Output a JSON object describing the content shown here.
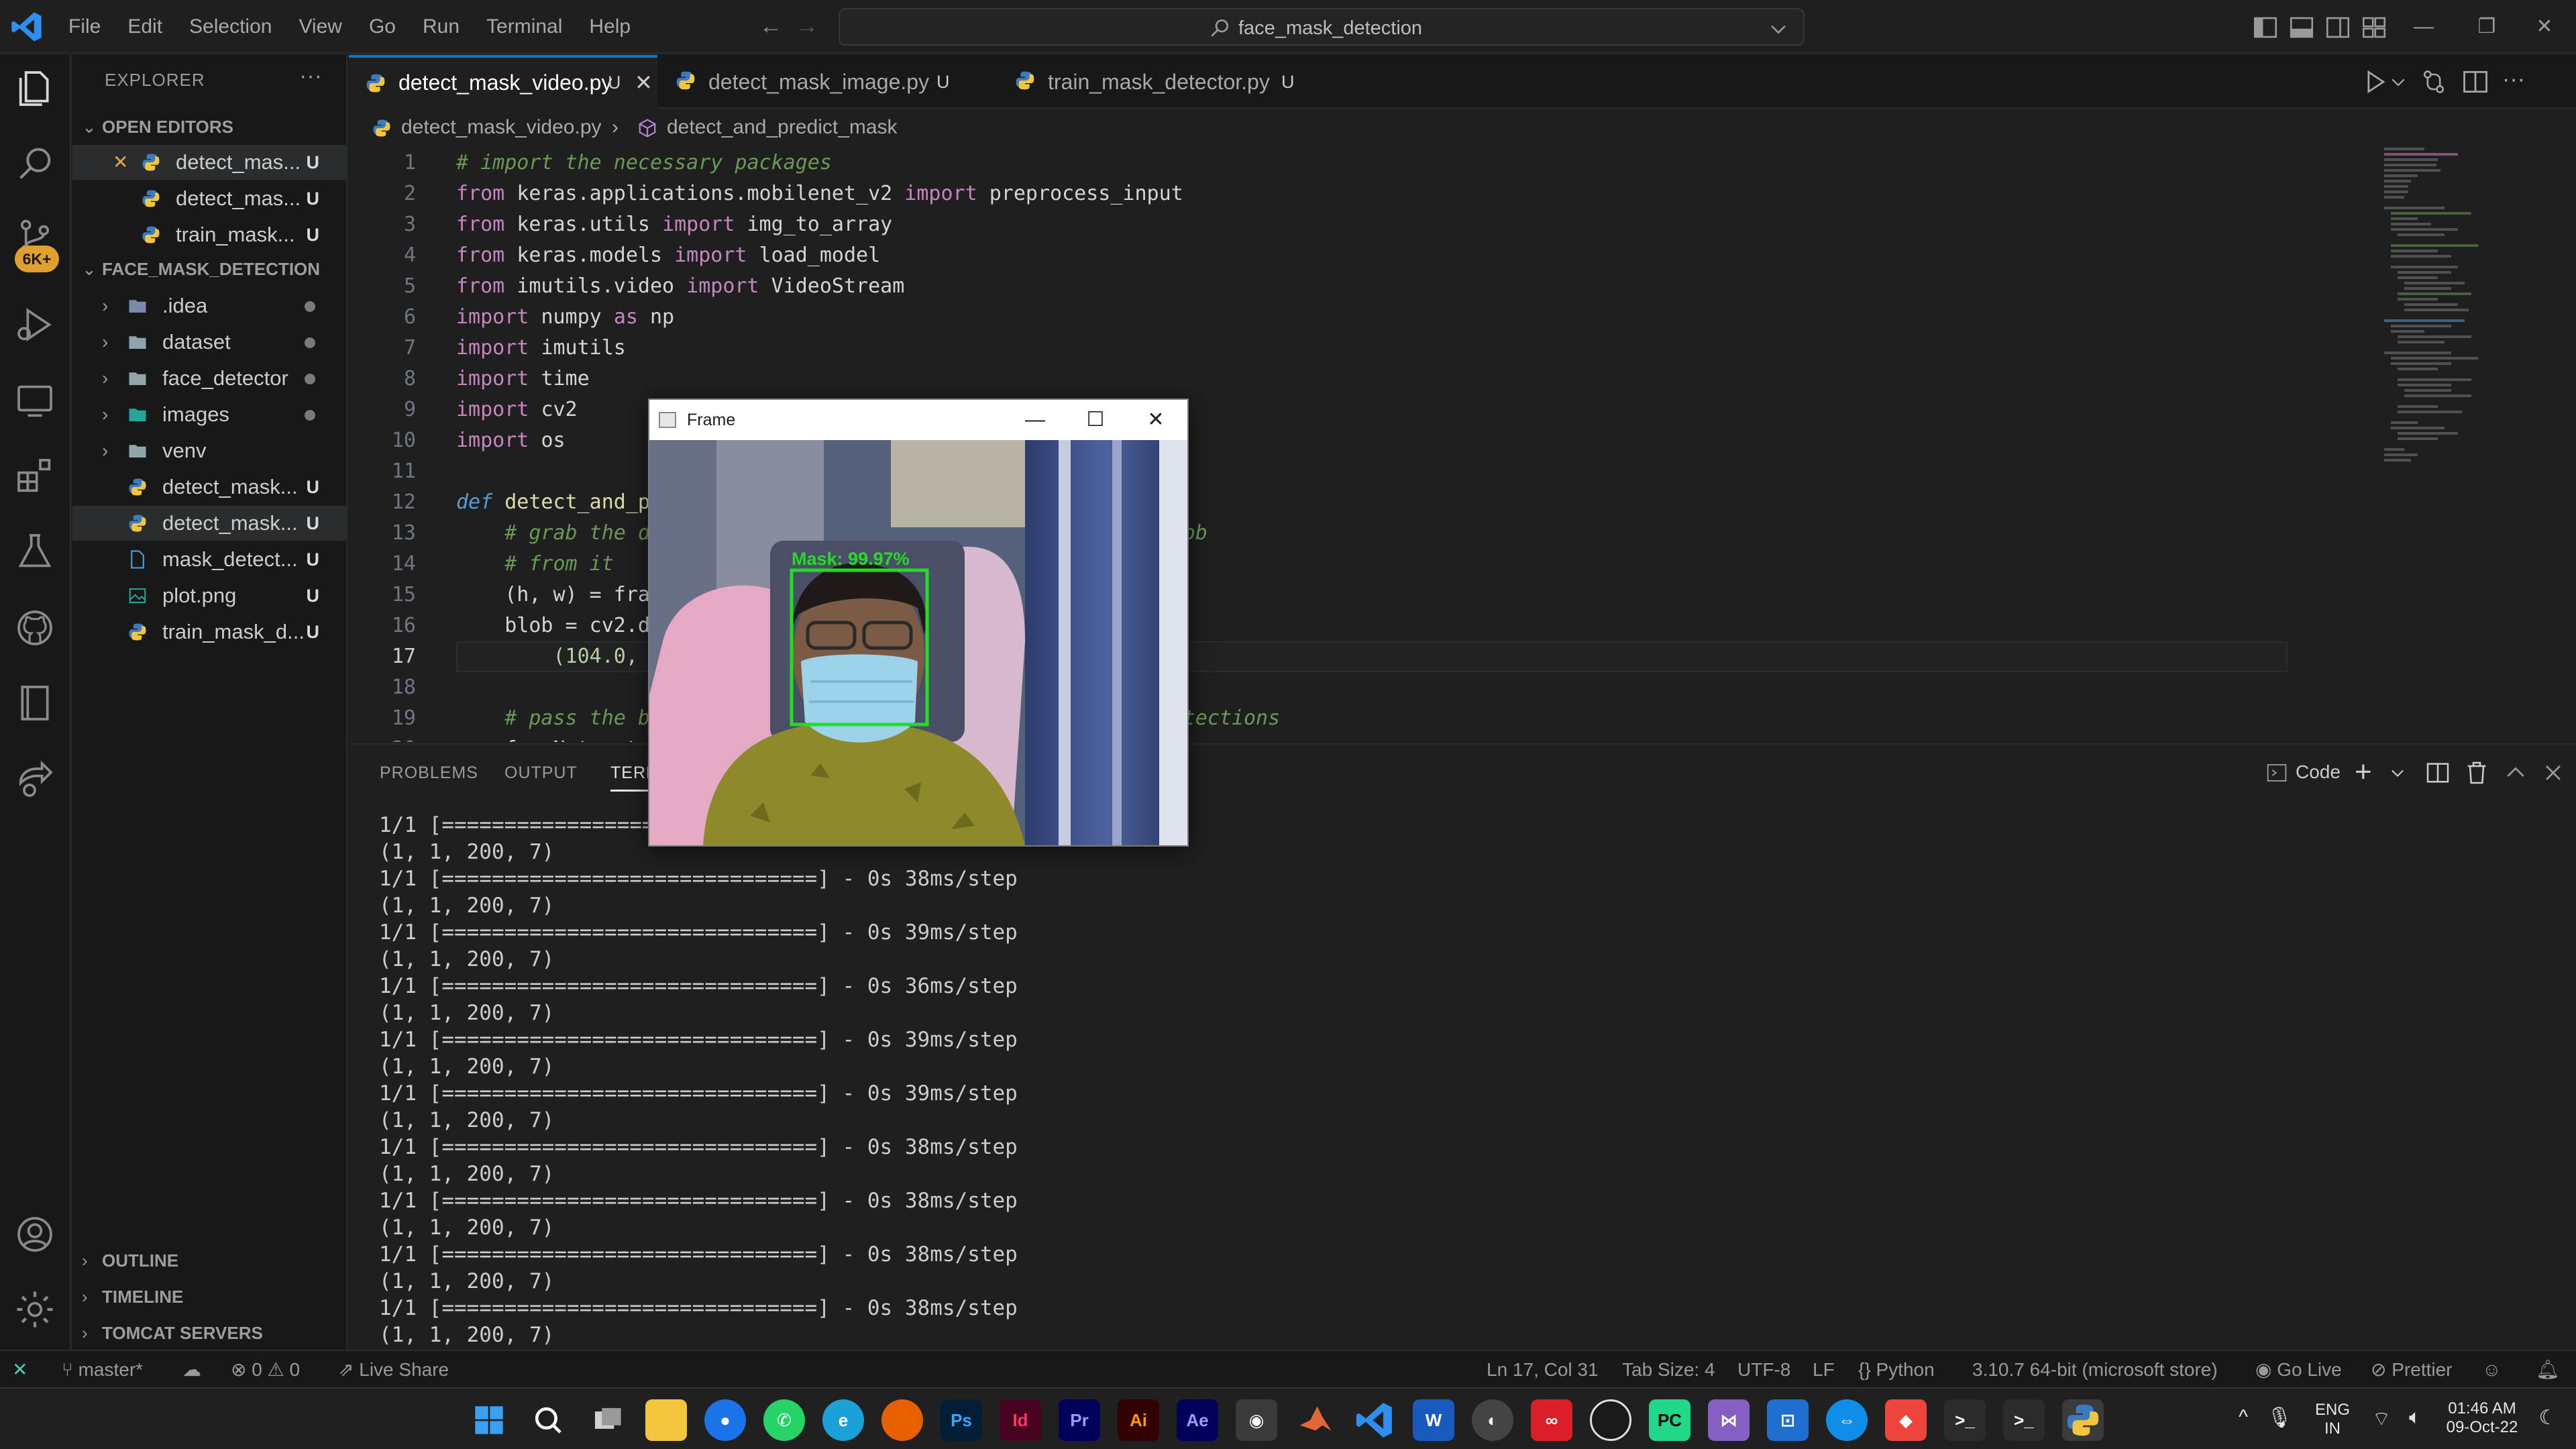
{
  "titlebar": {
    "menu": [
      "File",
      "Edit",
      "Selection",
      "View",
      "Go",
      "Run",
      "Terminal",
      "Help"
    ],
    "command_center": "face_mask_detection"
  },
  "activity_bar": {
    "items": [
      "explorer-icon",
      "search-icon",
      "source-control-icon",
      "run-debug-icon",
      "remote-explorer-icon",
      "extensions-icon",
      "testing-icon",
      "github-icon",
      "notebook-icon",
      "live-share-icon",
      "accounts-icon",
      "settings-gear-icon"
    ],
    "scm_badge": "6K+"
  },
  "sidebar": {
    "title": "EXPLORER",
    "open_editors_label": "OPEN EDITORS",
    "open_editors": [
      {
        "name": "detect_mas...",
        "status": "U"
      },
      {
        "name": "detect_mas...",
        "status": "U"
      },
      {
        "name": "train_mask...",
        "status": "U"
      }
    ],
    "project_label": "FACE_MASK_DETECTION",
    "tree": [
      {
        "name": ".idea",
        "type": "folder",
        "status": "dot"
      },
      {
        "name": "dataset",
        "type": "folder",
        "status": "dot"
      },
      {
        "name": "face_detector",
        "type": "folder",
        "status": "dot"
      },
      {
        "name": "images",
        "type": "folder",
        "status": "dot"
      },
      {
        "name": "venv",
        "type": "folder",
        "status": ""
      },
      {
        "name": "detect_mask...",
        "type": "py",
        "status": "U"
      },
      {
        "name": "detect_mask...",
        "type": "py",
        "status": "U"
      },
      {
        "name": "mask_detect...",
        "type": "file",
        "status": "U"
      },
      {
        "name": "plot.png",
        "type": "png",
        "status": "U"
      },
      {
        "name": "train_mask_d...",
        "type": "py",
        "status": "U"
      }
    ],
    "outline_label": "OUTLINE",
    "timeline_label": "TIMELINE",
    "tomcat_label": "TOMCAT SERVERS"
  },
  "tabs": [
    {
      "name": "detect_mask_video.py",
      "status": "U",
      "active": true
    },
    {
      "name": "detect_mask_image.py",
      "status": "U",
      "active": false
    },
    {
      "name": "train_mask_detector.py",
      "status": "U",
      "active": false
    }
  ],
  "breadcrumb": {
    "file": "detect_mask_video.py",
    "symbol": "detect_and_predict_mask"
  },
  "editor": {
    "current_line": 17,
    "lines": [
      {
        "n": "1",
        "tokens": [
          [
            "cm",
            "# import the necessary packages"
          ]
        ]
      },
      {
        "n": "2",
        "tokens": [
          [
            "kw",
            "from "
          ],
          [
            "id",
            "keras.applications.mobilenet_v2 "
          ],
          [
            "kw",
            "import "
          ],
          [
            "id",
            "preprocess_input"
          ]
        ]
      },
      {
        "n": "3",
        "tokens": [
          [
            "kw",
            "from "
          ],
          [
            "id",
            "keras.utils "
          ],
          [
            "kw",
            "import "
          ],
          [
            "id",
            "img_to_array"
          ]
        ]
      },
      {
        "n": "4",
        "tokens": [
          [
            "kw",
            "from "
          ],
          [
            "id",
            "keras.models "
          ],
          [
            "kw",
            "import "
          ],
          [
            "id",
            "load_model"
          ]
        ]
      },
      {
        "n": "5",
        "tokens": [
          [
            "kw",
            "from "
          ],
          [
            "id",
            "imutils.video "
          ],
          [
            "kw",
            "import "
          ],
          [
            "id",
            "VideoStream"
          ]
        ]
      },
      {
        "n": "6",
        "tokens": [
          [
            "kw",
            "import "
          ],
          [
            "id",
            "numpy "
          ],
          [
            "kw",
            "as "
          ],
          [
            "id",
            "np"
          ]
        ]
      },
      {
        "n": "7",
        "tokens": [
          [
            "kw",
            "import "
          ],
          [
            "id",
            "imutils"
          ]
        ]
      },
      {
        "n": "8",
        "tokens": [
          [
            "kw",
            "import "
          ],
          [
            "id",
            "time"
          ]
        ]
      },
      {
        "n": "9",
        "tokens": [
          [
            "kw",
            "import "
          ],
          [
            "id",
            "cv2"
          ]
        ]
      },
      {
        "n": "10",
        "tokens": [
          [
            "kw",
            "import "
          ],
          [
            "id",
            "os"
          ]
        ]
      },
      {
        "n": "11",
        "tokens": []
      },
      {
        "n": "12",
        "tokens": [
          [
            "df",
            "def "
          ],
          [
            "fn",
            "detect_and_p"
          ]
        ]
      },
      {
        "n": "13",
        "tokens": [
          [
            "cm",
            "    # grab the d                                          blob"
          ]
        ]
      },
      {
        "n": "14",
        "tokens": [
          [
            "cm",
            "    # from it"
          ]
        ]
      },
      {
        "n": "15",
        "tokens": [
          [
            "id",
            "    (h, w) = fra"
          ]
        ]
      },
      {
        "n": "16",
        "tokens": [
          [
            "id",
            "    blob = cv2.d"
          ]
        ]
      },
      {
        "n": "17",
        "tokens": [
          [
            "nm",
            "        (104.0,"
          ]
        ]
      },
      {
        "n": "18",
        "tokens": []
      },
      {
        "n": "19",
        "tokens": [
          [
            "cm",
            "    # pass the b                                          detections"
          ]
        ]
      },
      {
        "n": "20",
        "tokens": [
          [
            "id",
            "    faceNet.set"
          ]
        ]
      }
    ]
  },
  "panel": {
    "tabs": [
      "PROBLEMS",
      "OUTPUT",
      "TERMINAL"
    ],
    "active_tab": "TERMINAL",
    "terminal_name": "Code",
    "terminal_lines": [
      "1/1 [==============================] - 0s 38ms/step",
      "(1, 1, 200, 7)",
      "1/1 [==============================] - 0s 38ms/step",
      "(1, 1, 200, 7)",
      "1/1 [==============================] - 0s 39ms/step",
      "(1, 1, 200, 7)",
      "1/1 [==============================] - 0s 36ms/step",
      "(1, 1, 200, 7)",
      "1/1 [==============================] - 0s 39ms/step",
      "(1, 1, 200, 7)",
      "1/1 [==============================] - 0s 39ms/step",
      "(1, 1, 200, 7)",
      "1/1 [==============================] - 0s 38ms/step",
      "(1, 1, 200, 7)",
      "1/1 [==============================] - 0s 38ms/step",
      "(1, 1, 200, 7)",
      "1/1 [==============================] - 0s 38ms/step",
      "(1, 1, 200, 7)",
      "1/1 [==============================] - 0s 38ms/step",
      "(1, 1, 200, 7)"
    ]
  },
  "frame_window": {
    "title": "Frame",
    "detection_label": "Mask: 99.97%",
    "box_color": "#22dd22"
  },
  "statusbar": {
    "branch": "master*",
    "errors": "0",
    "warnings": "0",
    "live_share": "Live Share",
    "position": "Ln 17, Col 31",
    "tab_size": "Tab Size: 4",
    "encoding": "UTF-8",
    "eol": "LF",
    "language": "Python",
    "interpreter": "3.10.7 64-bit (microsoft store)",
    "go_live": "Go Live",
    "prettier": "Prettier"
  },
  "taskbar": {
    "apps": [
      "windows-start-icon",
      "search-icon",
      "task-view-icon",
      "file-explorer-icon",
      "chrome-icon",
      "whatsapp-icon",
      "edge-icon",
      "firefox-icon",
      "photoshop-icon",
      "indesign-icon",
      "premiere-icon",
      "illustrator-icon",
      "after-effects-icon",
      "camera-icon",
      "matlab-icon",
      "vscode-icon",
      "word-icon",
      "github-desktop-icon",
      "creative-cloud-icon",
      "obs-icon",
      "pycharm-icon",
      "visual-studio-icon",
      "jupyter-icon",
      "teamviewer-icon",
      "anydesk-icon",
      "terminal-icon",
      "cmd-icon",
      "python-icon"
    ],
    "lang": "ENG",
    "region": "IN",
    "time": "01:46 AM",
    "date": "09-Oct-22"
  },
  "colors": {
    "accent": "#0078d4",
    "keyword": "#c586c0",
    "comment": "#6a9955",
    "badge": "#e0a030"
  }
}
